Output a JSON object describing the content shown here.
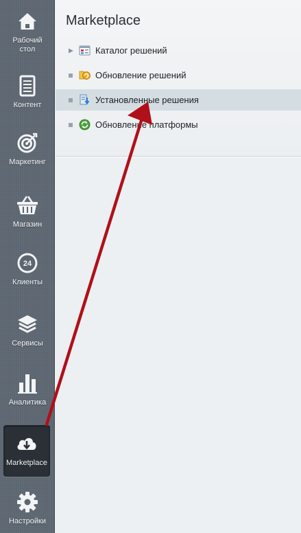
{
  "sidebar": {
    "items": [
      {
        "key": "desktop",
        "label": "Рабочий стол",
        "label_line1": "Рабочий",
        "label_line2": "стол",
        "icon": "home-icon"
      },
      {
        "key": "content",
        "label": "Контент",
        "icon": "document-icon"
      },
      {
        "key": "marketing",
        "label": "Маркетинг",
        "icon": "target-icon"
      },
      {
        "key": "shop",
        "label": "Магазин",
        "icon": "basket-icon"
      },
      {
        "key": "clients",
        "label": "Клиенты",
        "icon": "clients-24-icon",
        "icon_text": "24"
      },
      {
        "key": "services",
        "label": "Сервисы",
        "icon": "layers-icon"
      },
      {
        "key": "analytics",
        "label": "Аналитика",
        "icon": "bar-chart-icon"
      },
      {
        "key": "marketplace",
        "label": "Marketplace",
        "icon": "cloud-download-icon",
        "active": true
      },
      {
        "key": "settings",
        "label": "Настройки",
        "icon": "gear-icon"
      }
    ]
  },
  "main": {
    "title": "Marketplace",
    "menu": [
      {
        "label": "Каталог решений",
        "icon": "catalog-icon",
        "bullet": "triangle"
      },
      {
        "label": "Обновление решений",
        "icon": "update-solutions-icon",
        "bullet": "square"
      },
      {
        "label": "Установленные решения",
        "icon": "installed-solutions-icon",
        "bullet": "square",
        "active": true
      },
      {
        "label": "Обновление платформы",
        "icon": "platform-update-icon",
        "bullet": "square"
      }
    ]
  },
  "colors": {
    "sidebar_bg": "#5c6670",
    "active_bg": "#2a3036",
    "menu_active_bg": "#d4dde2",
    "annotation_arrow": "#b0101a"
  }
}
